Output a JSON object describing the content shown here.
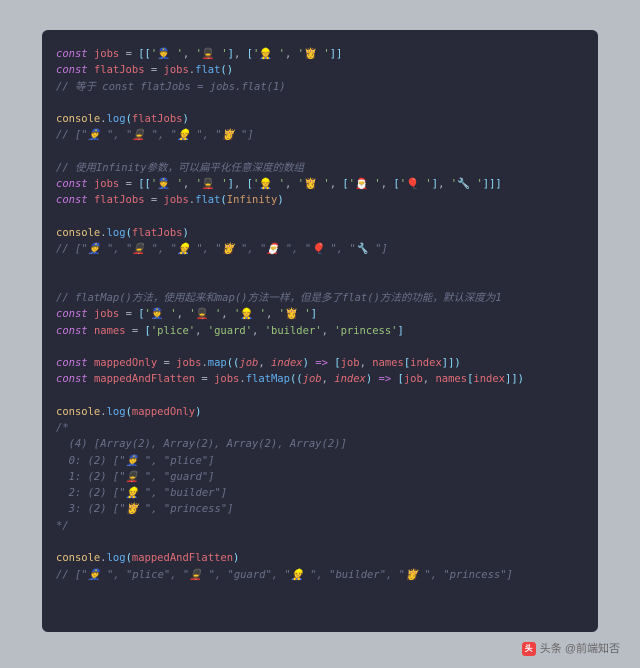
{
  "watermark": {
    "icon_text": "头",
    "label": "头条 @前端知否"
  },
  "code": {
    "l1": {
      "kw": "const",
      "var": "jobs",
      "str1": "'👮 '",
      "str2": "'💂 '",
      "str3": "'👷 '",
      "str4": "'👸 '"
    },
    "l2": {
      "kw": "const",
      "var": "flatJobs",
      "src": "jobs",
      "fn": "flat"
    },
    "l3": {
      "cm": "// 等于 const flatJobs = jobs.flat(1)"
    },
    "l5": {
      "obj": "console",
      "fn": "log",
      "arg": "flatJobs"
    },
    "l6": {
      "cm": "// [\"👮 \", \"💂 \", \"👷 \", \"👸 \"]"
    },
    "l8": {
      "cm": "// 使用Infinity参数，可以扁平化任意深度的数组"
    },
    "l9": {
      "kw": "const",
      "var": "jobs",
      "str1": "'👮 '",
      "str2": "'💂 '",
      "str3": "'👷 '",
      "str4": "'👸 '",
      "str5": "'🎅 '",
      "str6": "'🎈 '",
      "str7": "'🔧 '"
    },
    "l10": {
      "kw": "const",
      "var": "flatJobs",
      "src": "jobs",
      "fn": "flat",
      "arg": "Infinity"
    },
    "l12": {
      "obj": "console",
      "fn": "log",
      "arg": "flatJobs"
    },
    "l13": {
      "cm": "// [\"👮 \", \"💂 \", \"👷 \", \"👸 \", \"🎅 \", \"🎈 \", \"🔧 \"]"
    },
    "l16": {
      "cm": "// flatMap()方法，使用起来和map()方法一样，但是多了flat()方法的功能，默认深度为1"
    },
    "l17": {
      "kw": "const",
      "var": "jobs",
      "str1": "'👮 '",
      "str2": "'💂 '",
      "str3": "'👷 '",
      "str4": "'👸 '"
    },
    "l18": {
      "kw": "const",
      "var": "names",
      "str1": "'plice'",
      "str2": "'guard'",
      "str3": "'builder'",
      "str4": "'princess'"
    },
    "l20": {
      "kw": "const",
      "var": "mappedOnly",
      "src": "jobs",
      "fn": "map",
      "p1": "job",
      "p2": "index",
      "ret1": "job",
      "ret2": "names",
      "ret3": "index"
    },
    "l21": {
      "kw": "const",
      "var": "mappedAndFlatten",
      "src": "jobs",
      "fn": "flatMap",
      "p1": "job",
      "p2": "index",
      "ret1": "job",
      "ret2": "names",
      "ret3": "index"
    },
    "l23": {
      "obj": "console",
      "fn": "log",
      "arg": "mappedOnly"
    },
    "l24": {
      "cm": "/*"
    },
    "l25": {
      "cm": "  (4) [Array(2), Array(2), Array(2), Array(2)]"
    },
    "l26": {
      "cm": "  0: (2) [\"👮 \", \"plice\"]"
    },
    "l27": {
      "cm": "  1: (2) [\"💂 \", \"guard\"]"
    },
    "l28": {
      "cm": "  2: (2) [\"👷 \", \"builder\"]"
    },
    "l29": {
      "cm": "  3: (2) [\"👸 \", \"princess\"]"
    },
    "l30": {
      "cm": "*/"
    },
    "l32": {
      "obj": "console",
      "fn": "log",
      "arg": "mappedAndFlatten"
    },
    "l33": {
      "cm": "// [\"👮 \", \"plice\", \"💂 \", \"guard\", \"👷 \", \"builder\", \"👸 \", \"princess\"]"
    }
  }
}
